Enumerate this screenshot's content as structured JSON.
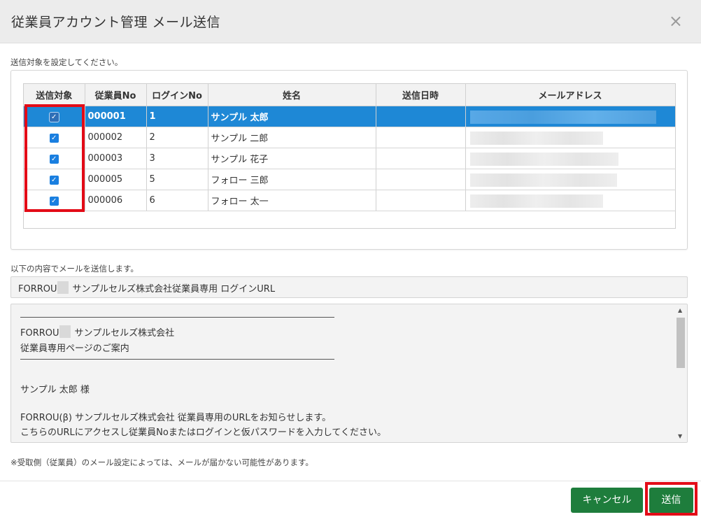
{
  "modal": {
    "title": "従業員アカウント管理 メール送信",
    "close_glyph": "×"
  },
  "recipients_label": "送信対象を設定してください。",
  "table": {
    "columns": [
      "送信対象",
      "従業員No",
      "ログインNo",
      "姓名",
      "送信日時",
      "メールアドレス"
    ],
    "rows": [
      {
        "checked": true,
        "employee_no": "000001",
        "login_no": "1",
        "name": "サンプル 太郎",
        "sent_at": "",
        "email": "",
        "selected": true
      },
      {
        "checked": true,
        "employee_no": "000002",
        "login_no": "2",
        "name": "サンプル 二郎",
        "sent_at": "",
        "email": "",
        "selected": false
      },
      {
        "checked": true,
        "employee_no": "000003",
        "login_no": "3",
        "name": "サンプル 花子",
        "sent_at": "",
        "email": "",
        "selected": false
      },
      {
        "checked": true,
        "employee_no": "000005",
        "login_no": "5",
        "name": "フォロー 三郎",
        "sent_at": "",
        "email": "",
        "selected": false
      },
      {
        "checked": true,
        "employee_no": "000006",
        "login_no": "6",
        "name": "フォロー 太一",
        "sent_at": "",
        "email": "",
        "selected": false
      }
    ]
  },
  "content_label": "以下の内容でメールを送信します。",
  "subject": {
    "prefix": "FORROU",
    "text": "サンプルセルズ株式会社従業員専用 ログインURL"
  },
  "body": {
    "company_prefix": "FORROU",
    "company": "サンプルセルズ株式会社",
    "heading": "従業員専用ページのご案内",
    "greeting": "サンプル 太郎 様",
    "line1": "FORROU(β) サンプルセルズ株式会社 従業員専用のURLをお知らせします。",
    "line2": "こちらのURLにアクセスし従業員Noまたはログインと仮パスワードを入力してください。",
    "scroll_up_glyph": "▲",
    "scroll_down_glyph": "▼"
  },
  "note": "※受取側（従業員）のメール設定によっては、メールが届かない可能性があります。",
  "footer": {
    "cancel_label": "キャンセル",
    "send_label": "送信"
  },
  "colors": {
    "primary_button": "#1e7d3c",
    "selected_row": "#1e88d6",
    "highlight": "#e30b17"
  }
}
